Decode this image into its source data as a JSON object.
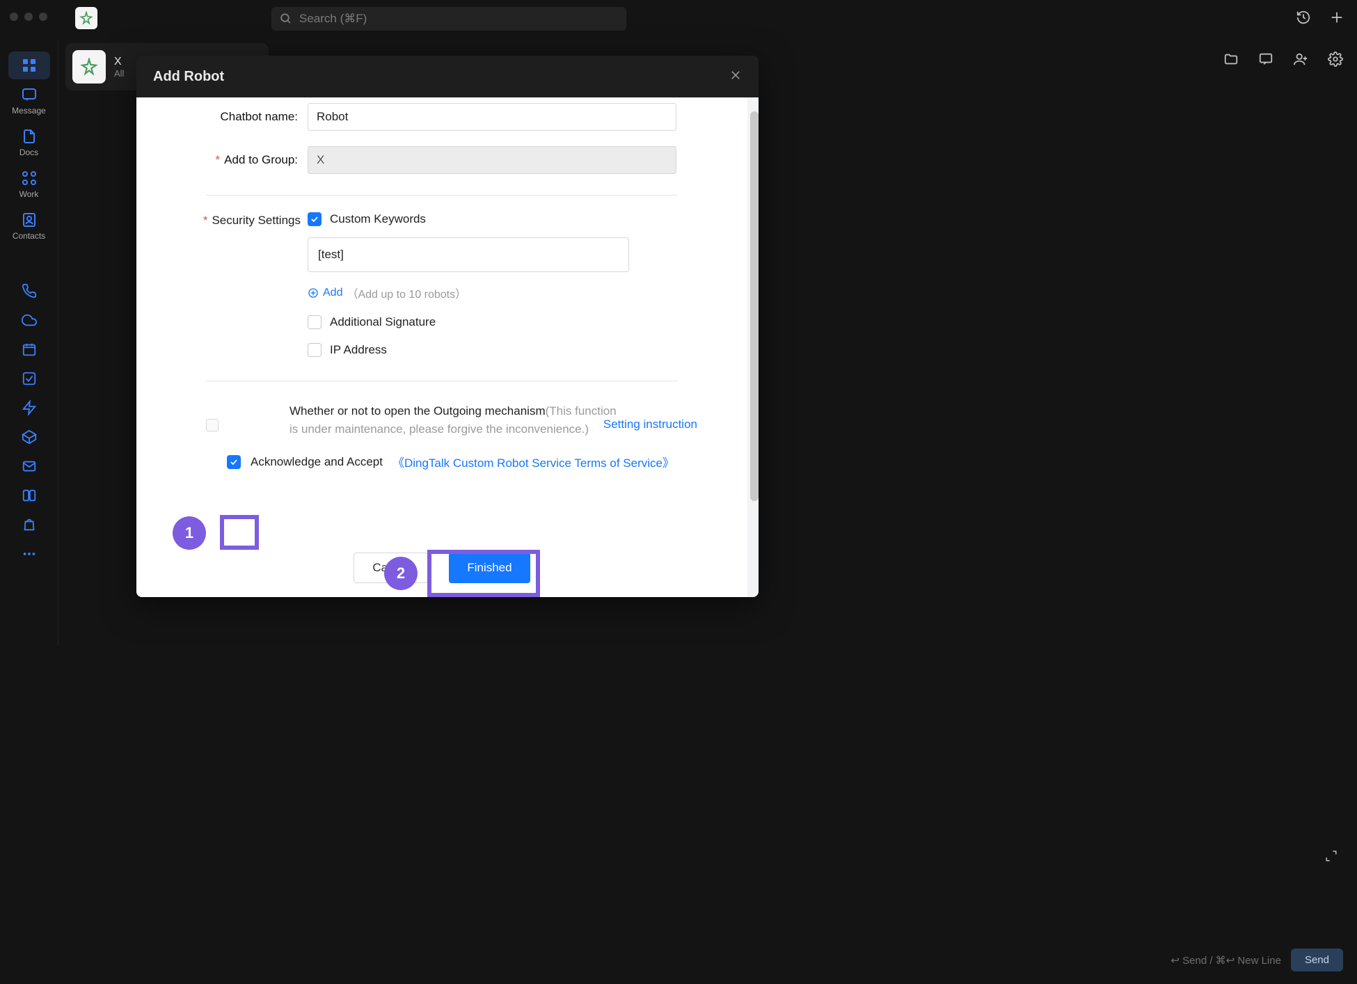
{
  "window": {
    "title": "X"
  },
  "search": {
    "placeholder": "Search (⌘F)"
  },
  "rail": {
    "apps": "",
    "message": "Message",
    "docs": "Docs",
    "work": "Work",
    "contacts": "Contacts"
  },
  "chat": {
    "title": "X",
    "subtitle": "All"
  },
  "send": {
    "hint": "↩ Send / ⌘↩ New Line",
    "button": "Send"
  },
  "modal": {
    "title": "Add Robot",
    "form": {
      "chatbot_name_label": "Chatbot name:",
      "chatbot_name_value": "Robot",
      "add_to_group_label": "Add to Group:",
      "add_to_group_value": "X",
      "security_label": "Security Settings",
      "custom_keywords_label": "Custom Keywords",
      "keyword_value": "[test]",
      "add_label": "Add",
      "add_hint": "（Add up to 10 robots）",
      "additional_signature_label": "Additional Signature",
      "ip_address_label": "IP Address",
      "outgoing_label": "Whether or not to open the Outgoing mechanism",
      "outgoing_hint": "(This function is under maintenance, please forgive the inconvenience.)",
      "setting_instruction": "Setting instruction",
      "terms_ack": "Acknowledge and Accept",
      "terms_link": "《DingTalk Custom Robot Service Terms of Service》",
      "cancel": "Cancel",
      "finished": "Finished"
    }
  },
  "annotations": {
    "badge1": "1",
    "badge2": "2"
  }
}
